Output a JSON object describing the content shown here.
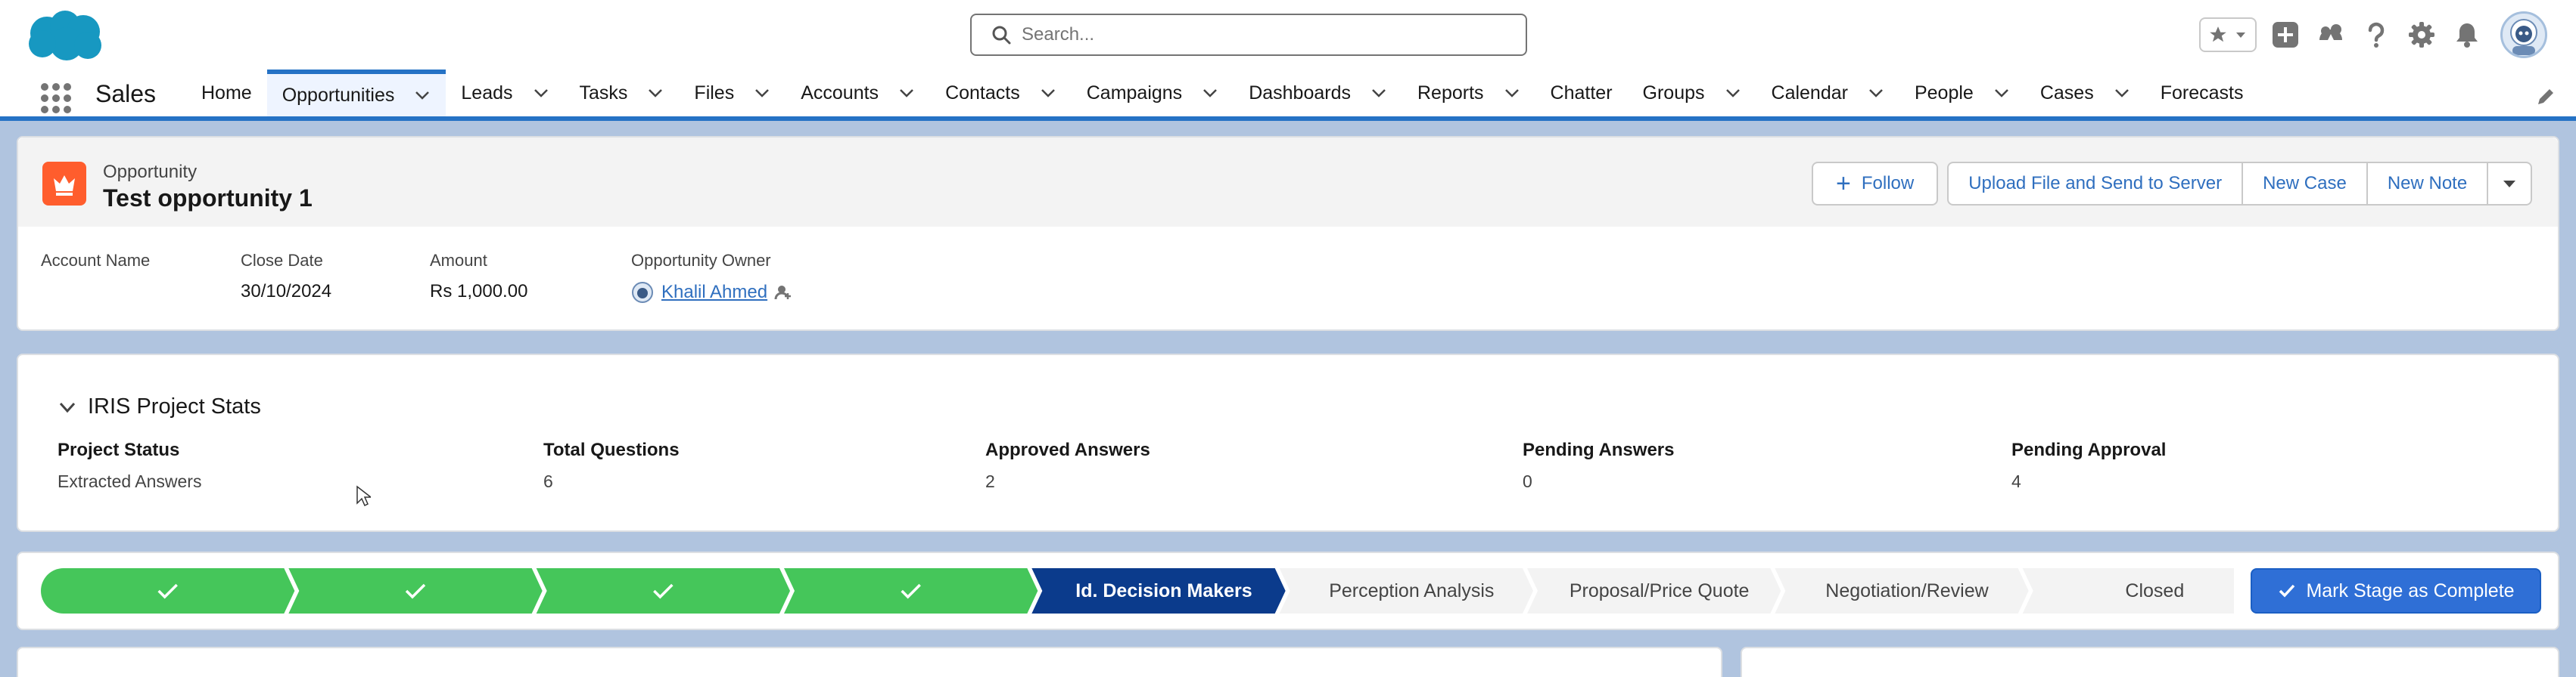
{
  "global_header": {
    "search_placeholder": "Search..."
  },
  "nav": {
    "app_name": "Sales",
    "items": [
      {
        "label": "Home",
        "has_menu": false,
        "active": false
      },
      {
        "label": "Opportunities",
        "has_menu": true,
        "active": true
      },
      {
        "label": "Leads",
        "has_menu": true,
        "active": false
      },
      {
        "label": "Tasks",
        "has_menu": true,
        "active": false
      },
      {
        "label": "Files",
        "has_menu": true,
        "active": false
      },
      {
        "label": "Accounts",
        "has_menu": true,
        "active": false
      },
      {
        "label": "Contacts",
        "has_menu": true,
        "active": false
      },
      {
        "label": "Campaigns",
        "has_menu": true,
        "active": false
      },
      {
        "label": "Dashboards",
        "has_menu": true,
        "active": false
      },
      {
        "label": "Reports",
        "has_menu": true,
        "active": false
      },
      {
        "label": "Chatter",
        "has_menu": false,
        "active": false
      },
      {
        "label": "Groups",
        "has_menu": true,
        "active": false
      },
      {
        "label": "Calendar",
        "has_menu": true,
        "active": false
      },
      {
        "label": "People",
        "has_menu": true,
        "active": false
      },
      {
        "label": "Cases",
        "has_menu": true,
        "active": false
      },
      {
        "label": "Forecasts",
        "has_menu": false,
        "active": false
      }
    ]
  },
  "record": {
    "type_label": "Opportunity",
    "name": "Test opportunity 1",
    "actions": {
      "follow": "Follow",
      "upload": "Upload File and Send to Server",
      "new_case": "New Case",
      "new_note": "New Note"
    },
    "fields": {
      "account_name_label": "Account Name",
      "account_name_value": "",
      "close_date_label": "Close Date",
      "close_date_value": "30/10/2024",
      "amount_label": "Amount",
      "amount_value": "Rs 1,000.00",
      "owner_label": "Opportunity Owner",
      "owner_value": "Khalil Ahmed"
    }
  },
  "stats": {
    "title": "IRIS Project Stats",
    "items": [
      {
        "label": "Project Status",
        "value": "Extracted Answers"
      },
      {
        "label": "Total Questions",
        "value": "6"
      },
      {
        "label": "Approved Answers",
        "value": "2"
      },
      {
        "label": "Pending Answers",
        "value": "0"
      },
      {
        "label": "Pending Approval",
        "value": "4"
      }
    ]
  },
  "path": {
    "stages": [
      {
        "label": "",
        "status": "complete"
      },
      {
        "label": "",
        "status": "complete"
      },
      {
        "label": "",
        "status": "complete"
      },
      {
        "label": "",
        "status": "complete"
      },
      {
        "label": "Id. Decision Makers",
        "status": "current"
      },
      {
        "label": "Perception Analysis",
        "status": "incomplete"
      },
      {
        "label": "Proposal/Price Quote",
        "status": "incomplete"
      },
      {
        "label": "Negotiation/Review",
        "status": "incomplete"
      },
      {
        "label": "Closed",
        "status": "incomplete"
      }
    ],
    "mark_complete_label": "Mark Stage as Complete"
  },
  "colors": {
    "brand_blue": "#2572c5",
    "complete_green": "#45c65a",
    "current_navy": "#0b3b8c",
    "incomplete_gray": "#f3f3f3",
    "opportunity_orange": "#ff5d2d",
    "link_blue": "#2f6fbf"
  },
  "icons": {
    "logo": "salesforce-cloud-logo",
    "search": "search-icon",
    "favorites": "star-icon",
    "global_actions": "plus-icon",
    "trailhead": "trailhead-icon",
    "help": "help-icon",
    "setup": "gear-icon",
    "notifications": "bell-icon",
    "record_type": "crown-icon",
    "stage_complete": "check-icon"
  }
}
